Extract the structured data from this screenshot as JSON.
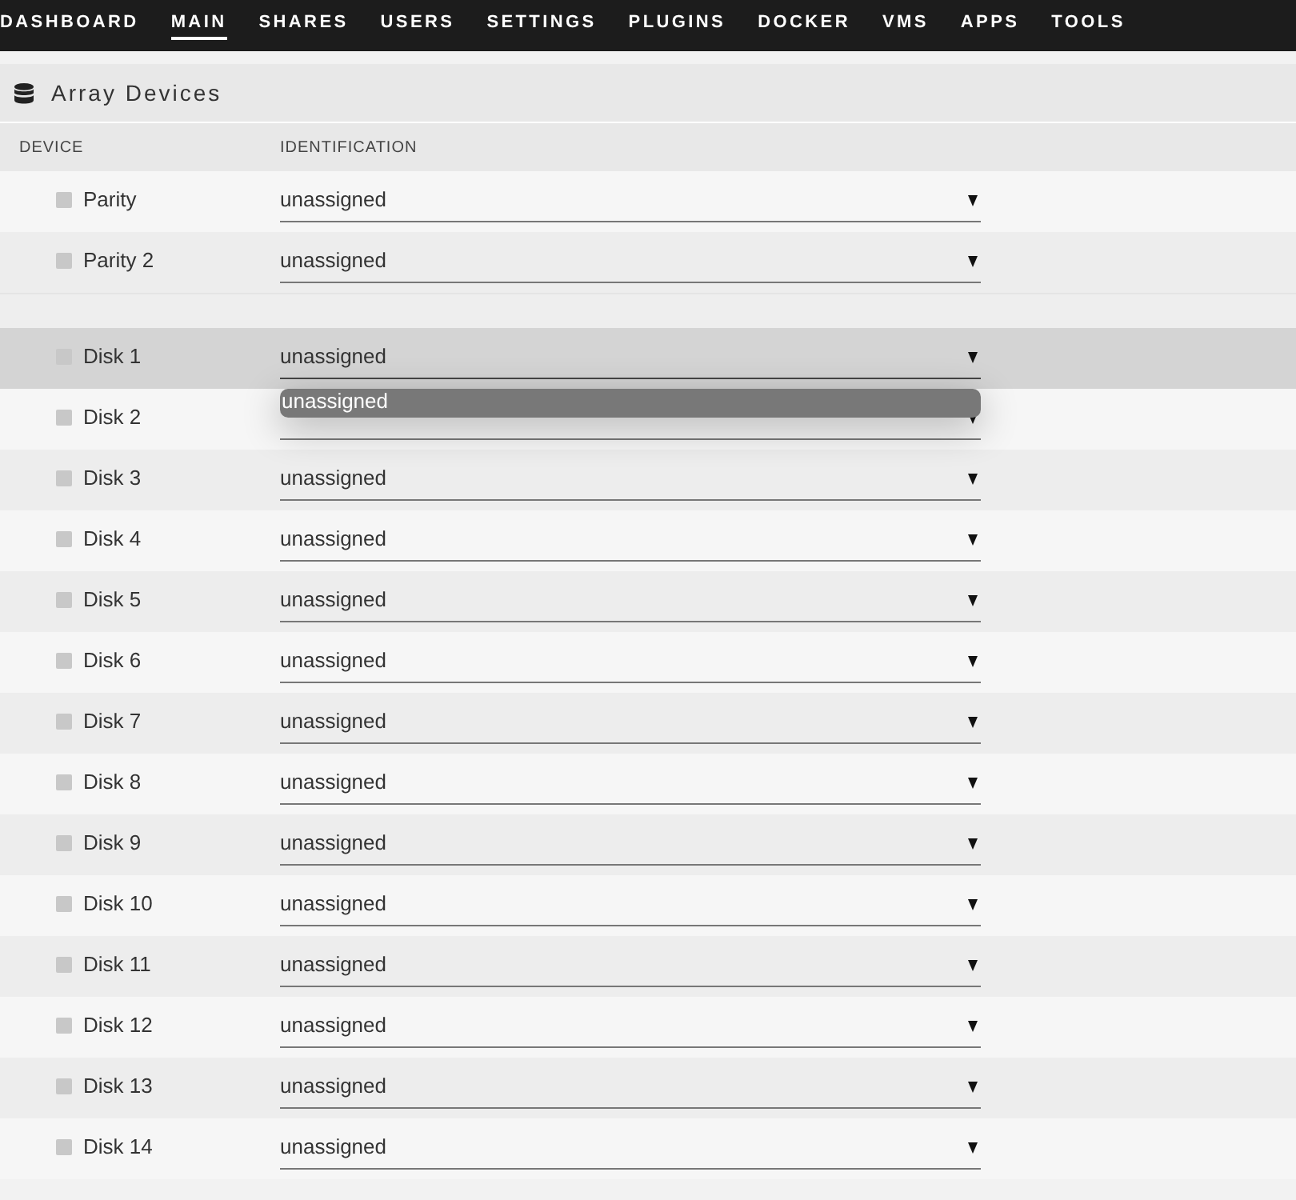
{
  "nav": {
    "tabs": [
      {
        "label": "DASHBOARD",
        "selected": false
      },
      {
        "label": "MAIN",
        "selected": true
      },
      {
        "label": "SHARES",
        "selected": false
      },
      {
        "label": "USERS",
        "selected": false
      },
      {
        "label": "SETTINGS",
        "selected": false
      },
      {
        "label": "PLUGINS",
        "selected": false
      },
      {
        "label": "DOCKER",
        "selected": false
      },
      {
        "label": "VMS",
        "selected": false
      },
      {
        "label": "APPS",
        "selected": false
      },
      {
        "label": "TOOLS",
        "selected": false
      }
    ]
  },
  "panel": {
    "title": "Array Devices",
    "columns": [
      "DEVICE",
      "IDENTIFICATION"
    ],
    "rows": [
      {
        "kind": "device",
        "name": "Parity",
        "identification": "unassigned",
        "hovered": false,
        "expanded": false
      },
      {
        "kind": "device",
        "name": "Parity 2",
        "identification": "unassigned",
        "hovered": false,
        "expanded": false
      },
      {
        "kind": "spacer"
      },
      {
        "kind": "device",
        "name": "Disk 1",
        "identification": "unassigned",
        "hovered": true,
        "expanded": true,
        "options": [
          {
            "label": "unassigned",
            "highlighted": true
          }
        ]
      },
      {
        "kind": "device",
        "name": "Disk 2",
        "hovered": false,
        "expanded": false
      },
      {
        "kind": "device",
        "name": "Disk 3",
        "identification": "unassigned",
        "hovered": false,
        "expanded": false
      },
      {
        "kind": "device",
        "name": "Disk 4",
        "identification": "unassigned",
        "hovered": false,
        "expanded": false
      },
      {
        "kind": "device",
        "name": "Disk 5",
        "identification": "unassigned",
        "hovered": false,
        "expanded": false
      },
      {
        "kind": "device",
        "name": "Disk 6",
        "identification": "unassigned",
        "hovered": false,
        "expanded": false
      },
      {
        "kind": "device",
        "name": "Disk 7",
        "identification": "unassigned",
        "hovered": false,
        "expanded": false
      },
      {
        "kind": "device",
        "name": "Disk 8",
        "identification": "unassigned",
        "hovered": false,
        "expanded": false
      },
      {
        "kind": "device",
        "name": "Disk 9",
        "identification": "unassigned",
        "hovered": false,
        "expanded": false
      },
      {
        "kind": "device",
        "name": "Disk 10",
        "identification": "unassigned",
        "hovered": false,
        "expanded": false
      },
      {
        "kind": "device",
        "name": "Disk 11",
        "identification": "unassigned",
        "hovered": false,
        "expanded": false
      },
      {
        "kind": "device",
        "name": "Disk 12",
        "identification": "unassigned",
        "hovered": false,
        "expanded": false
      },
      {
        "kind": "device",
        "name": "Disk 13",
        "identification": "unassigned",
        "hovered": false,
        "expanded": false
      },
      {
        "kind": "device",
        "name": "Disk 14",
        "identification": "unassigned",
        "hovered": false,
        "expanded": false
      }
    ]
  }
}
